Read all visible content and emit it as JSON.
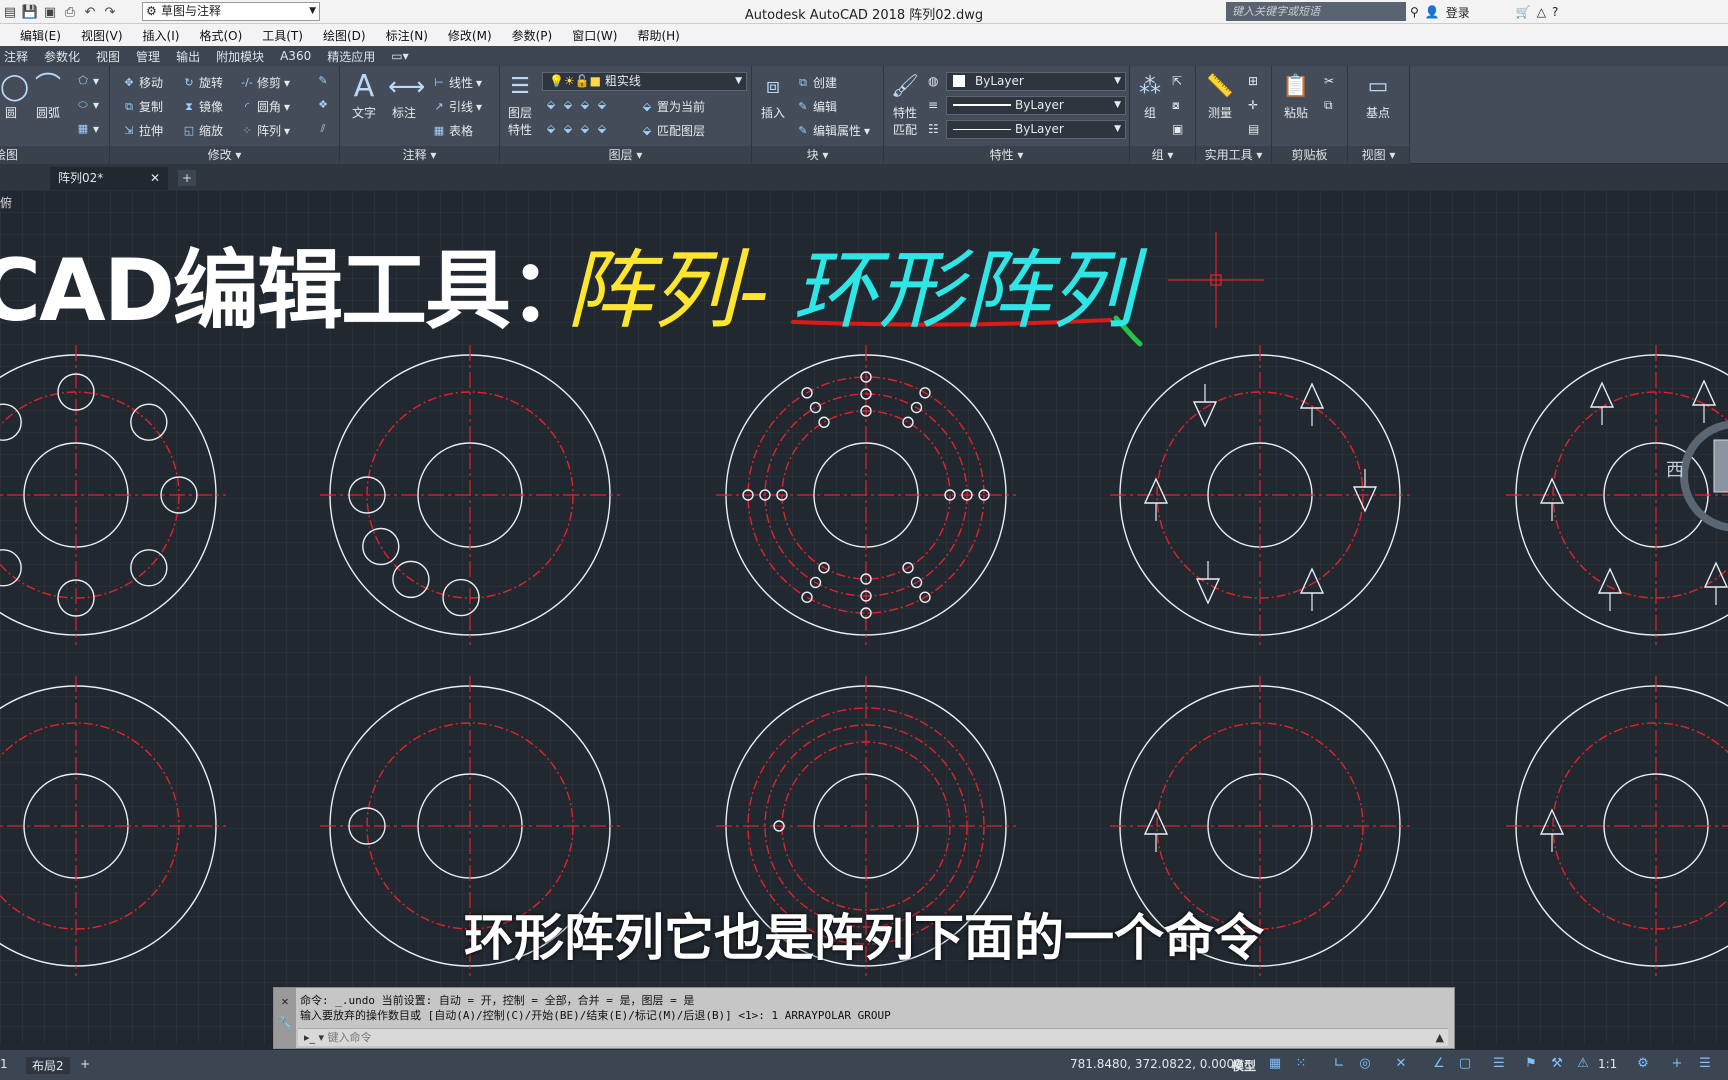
{
  "titlebar": {
    "workspace": "草图与注释",
    "app_title": "Autodesk AutoCAD 2018    阵列02.dwg",
    "search_placeholder": "键入关键字或短语",
    "login": "登录"
  },
  "menu": [
    "编辑(E)",
    "视图(V)",
    "插入(I)",
    "格式(O)",
    "工具(T)",
    "绘图(D)",
    "标注(N)",
    "修改(M)",
    "参数(P)",
    "窗口(W)",
    "帮助(H)"
  ],
  "ribbon_tabs": [
    "注释",
    "参数化",
    "视图",
    "管理",
    "输出",
    "附加模块",
    "A360",
    "精选应用"
  ],
  "ribbon": {
    "draw": {
      "circle": "圆",
      "arc": "圆弧",
      "title": "绘图"
    },
    "modify": {
      "move": "移动",
      "rotate": "旋转",
      "trim": "修剪",
      "copy": "复制",
      "mirror": "镜像",
      "fillet": "圆角",
      "stretch": "拉伸",
      "scale": "缩放",
      "array": "阵列",
      "title": "修改"
    },
    "annotation": {
      "text": "文字",
      "dimension": "标注",
      "linear": "线性",
      "leader": "引线",
      "table": "表格",
      "title": "注释"
    },
    "layers": {
      "layer_props_1": "图层",
      "layer_props_2": "特性",
      "current_layer": "粗实线",
      "make_current": "置为当前",
      "match_layer": "匹配图层",
      "title": "图层"
    },
    "block": {
      "insert": "插入",
      "create": "创建",
      "edit": "编辑",
      "edit_attr": "编辑属性",
      "title": "块"
    },
    "properties": {
      "match_1": "特性",
      "match_2": "匹配",
      "color": "ByLayer",
      "linetype": "ByLayer",
      "lineweight": "ByLayer",
      "title": "特性"
    },
    "groups": {
      "group": "组",
      "title": "组"
    },
    "utilities": {
      "measure": "测量",
      "title": "实用工具"
    },
    "clipboard": {
      "paste": "粘贴",
      "title": "剪贴板"
    },
    "view": {
      "base": "基点",
      "title": "视图"
    }
  },
  "file_tab": "阵列02*",
  "canvas": {
    "view_label": "俯",
    "heading_white": "CAD编辑工具：",
    "heading_yellow": "阵列-",
    "heading_cyan": "环形阵列",
    "viewcube_west": "西",
    "subtitle": "环形阵列它也是阵列下面的一个命令"
  },
  "command": {
    "line1": "命令: _.undo 当前设置: 自动 = 开，控制 = 全部，合并 = 是，图层 = 是",
    "line2": "输入要放弃的操作数目或 [自动(A)/控制(C)/开始(BE)/结束(E)/标记(M)/后退(B)] <1>: 1 ARRAYPOLAR GROUP",
    "placeholder": "键入命令"
  },
  "layout_tabs": [
    "1",
    "布局2"
  ],
  "status": {
    "coords": "781.8480, 372.0822, 0.0000",
    "model": "模型",
    "scale": "1:1"
  },
  "colors": {
    "canvas_bg": "#212830",
    "centerline": "#e0232d",
    "geometry": "#e8eef4",
    "heading_yellow": "#ffe62e",
    "heading_cyan": "#2ee6e6"
  }
}
